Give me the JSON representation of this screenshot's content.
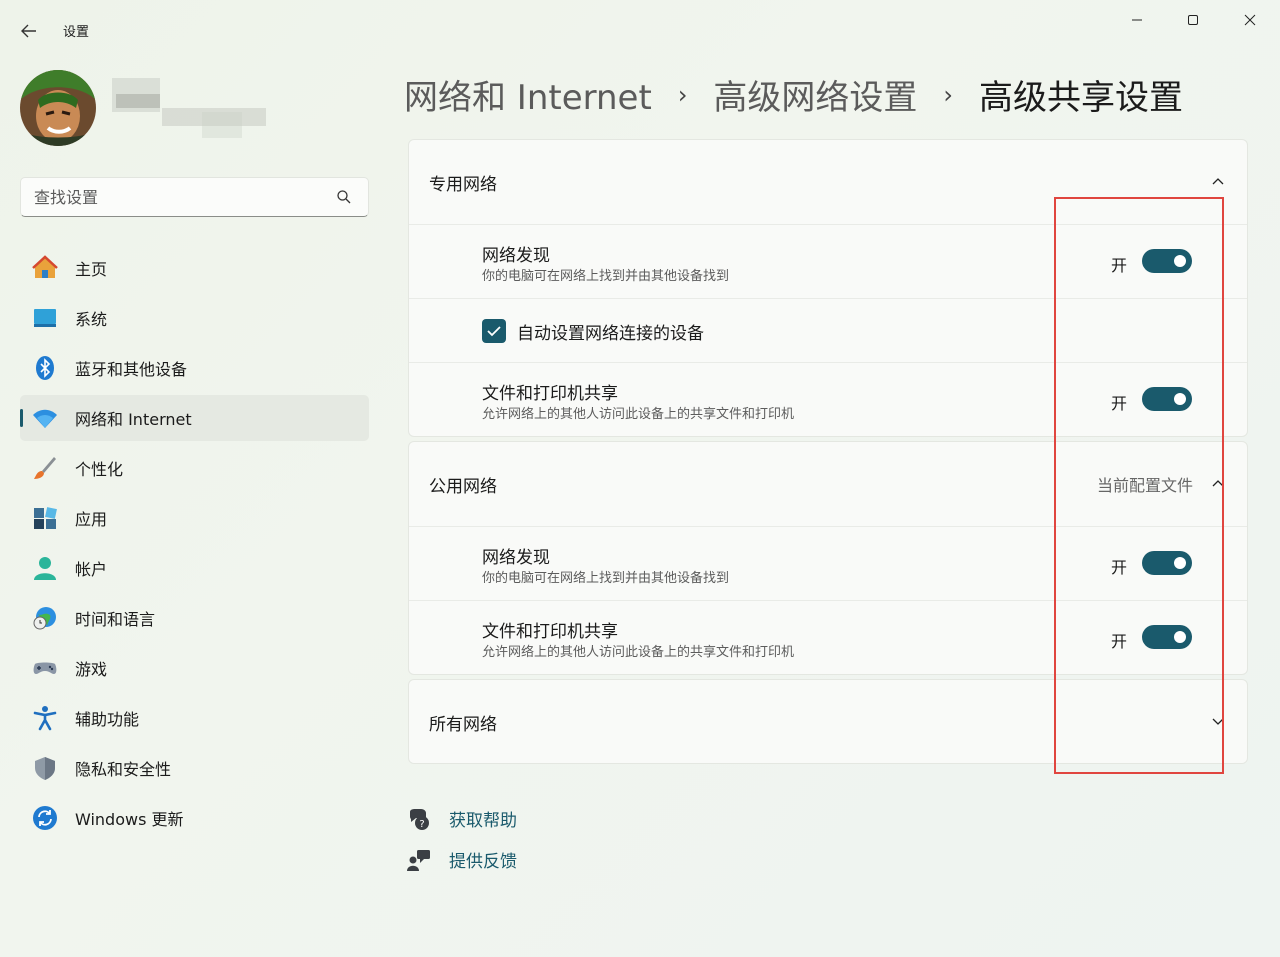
{
  "window": {
    "title": "设置",
    "back_icon": "back-arrow-icon",
    "controls": [
      "minimize-icon",
      "maximize-icon",
      "close-icon"
    ]
  },
  "search": {
    "placeholder": "查找设置",
    "icon": "search-icon"
  },
  "sidebar": {
    "items": [
      {
        "label": "主页",
        "icon": "home-icon"
      },
      {
        "label": "系统",
        "icon": "system-icon"
      },
      {
        "label": "蓝牙和其他设备",
        "icon": "bluetooth-icon"
      },
      {
        "label": "网络和 Internet",
        "icon": "wifi-icon",
        "selected": true
      },
      {
        "label": "个性化",
        "icon": "brush-icon"
      },
      {
        "label": "应用",
        "icon": "apps-icon"
      },
      {
        "label": "帐户",
        "icon": "account-icon"
      },
      {
        "label": "时间和语言",
        "icon": "globe-clock-icon"
      },
      {
        "label": "游戏",
        "icon": "gamepad-icon"
      },
      {
        "label": "辅助功能",
        "icon": "accessibility-icon"
      },
      {
        "label": "隐私和安全性",
        "icon": "shield-icon"
      },
      {
        "label": "Windows 更新",
        "icon": "update-icon"
      }
    ]
  },
  "breadcrumb": {
    "items": [
      "网络和 Internet",
      "高级网络设置",
      "高级共享设置"
    ],
    "separator": "›"
  },
  "private_network": {
    "title": "专用网络",
    "discovery": {
      "title": "网络发现",
      "desc": "你的电脑可在网络上找到并由其他设备找到",
      "state": "开"
    },
    "auto_setup": {
      "label": "自动设置网络连接的设备",
      "checked": true
    },
    "file_sharing": {
      "title": "文件和打印机共享",
      "desc": "允许网络上的其他人访问此设备上的共享文件和打印机",
      "state": "开"
    }
  },
  "public_network": {
    "title": "公用网络",
    "profile_note": "当前配置文件",
    "discovery": {
      "title": "网络发现",
      "desc": "你的电脑可在网络上找到并由其他设备找到",
      "state": "开"
    },
    "file_sharing": {
      "title": "文件和打印机共享",
      "desc": "允许网络上的其他人访问此设备上的共享文件和打印机",
      "state": "开"
    }
  },
  "all_networks": {
    "title": "所有网络"
  },
  "links": {
    "help": "获取帮助",
    "feedback": "提供反馈"
  },
  "colors": {
    "accent": "#1a5a6c",
    "annotation_box": "#e0453f"
  }
}
